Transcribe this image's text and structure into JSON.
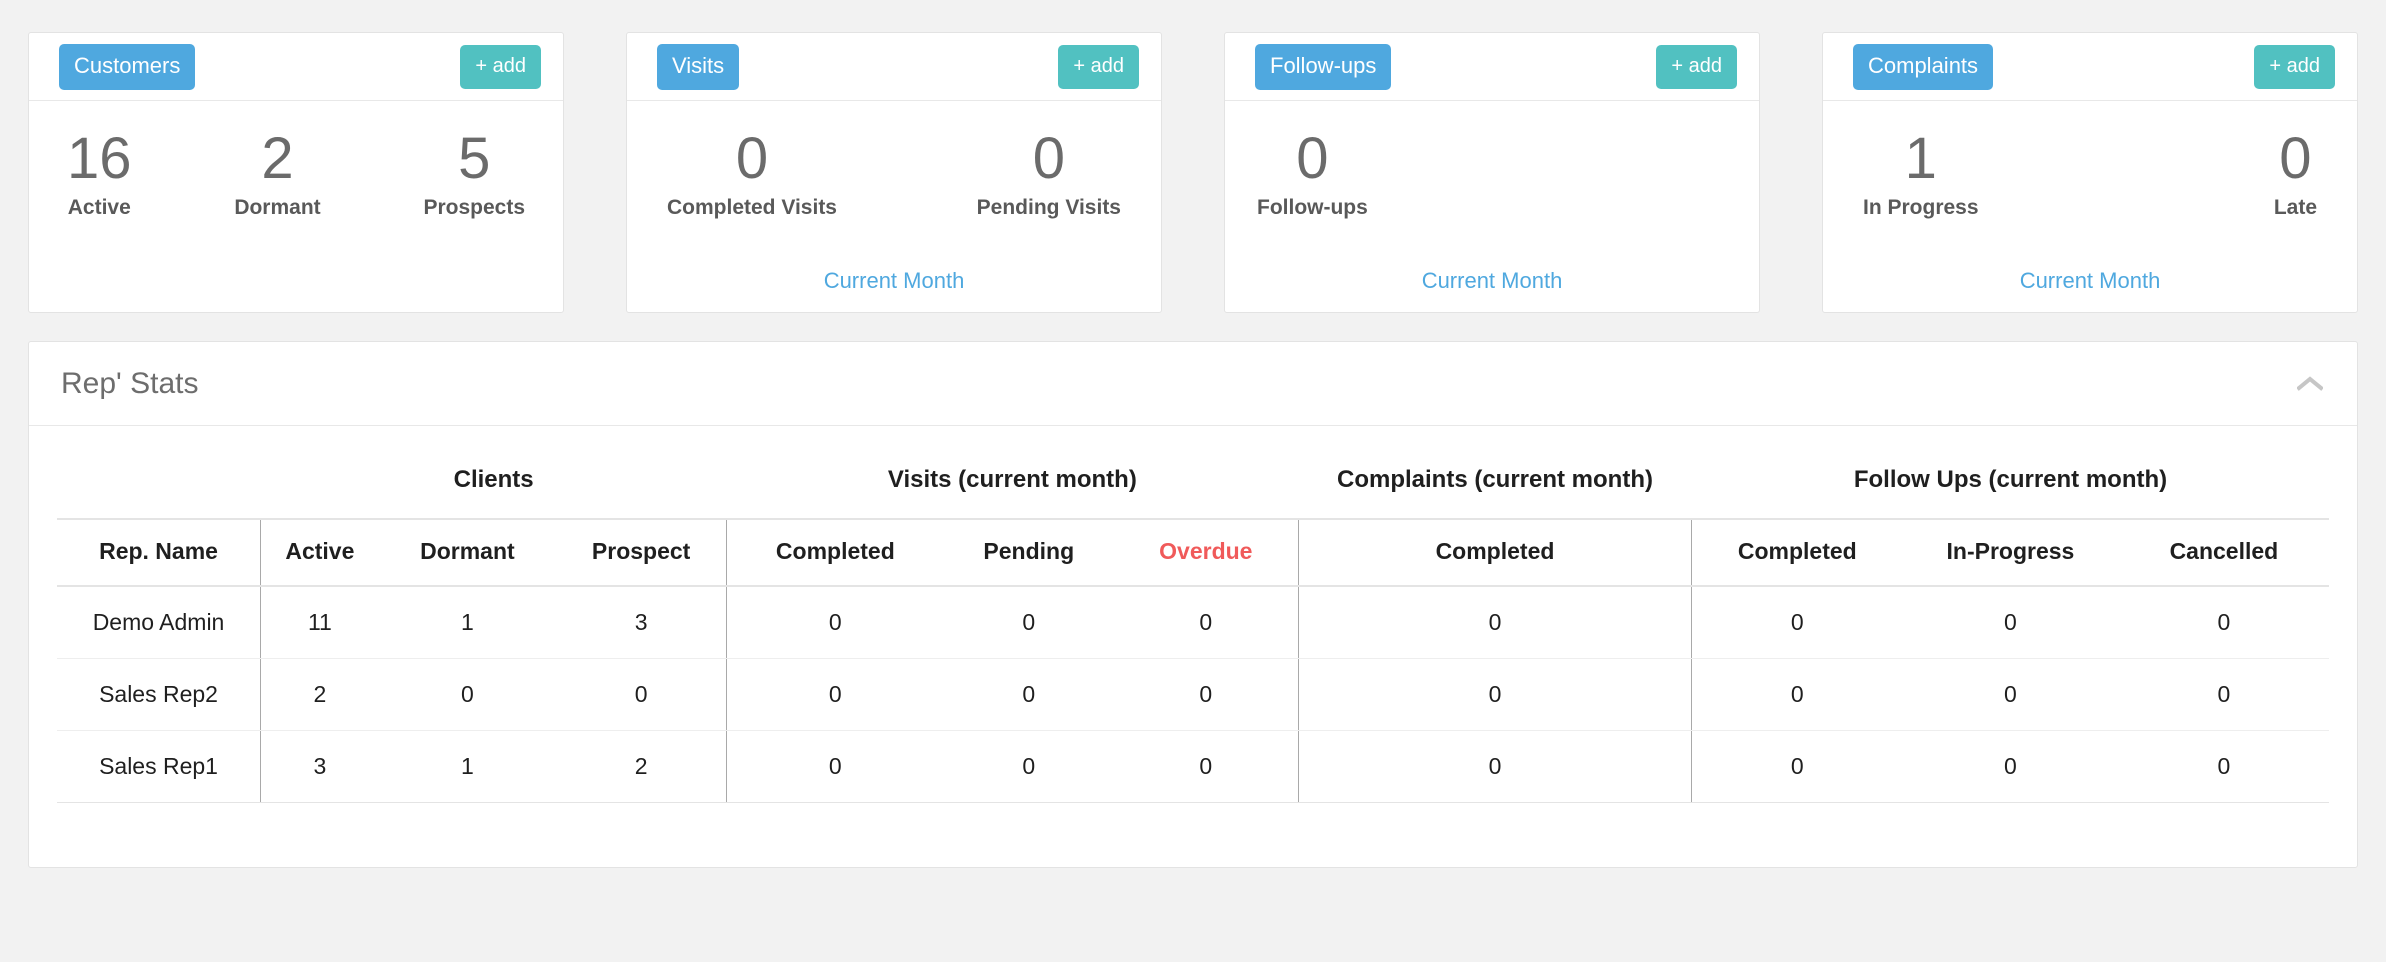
{
  "cards": [
    {
      "name": "customers",
      "badge_label": "Customers",
      "add_label": "+ add",
      "layout": "three",
      "stats": [
        {
          "value": "16",
          "label": "Active"
        },
        {
          "value": "2",
          "label": "Dormant"
        },
        {
          "value": "5",
          "label": "Prospects"
        }
      ],
      "footer_link": ""
    },
    {
      "name": "visits",
      "badge_label": "Visits",
      "add_label": "+ add",
      "layout": "two",
      "stats": [
        {
          "value": "0",
          "label": "Completed Visits"
        },
        {
          "value": "0",
          "label": "Pending Visits"
        }
      ],
      "footer_link": "Current Month"
    },
    {
      "name": "follow-ups",
      "badge_label": "Follow-ups",
      "add_label": "+ add",
      "layout": "one",
      "stats": [
        {
          "value": "0",
          "label": "Follow-ups"
        }
      ],
      "footer_link": "Current Month"
    },
    {
      "name": "complaints",
      "badge_label": "Complaints",
      "add_label": "+ add",
      "layout": "two",
      "stats": [
        {
          "value": "1",
          "label": "In Progress"
        },
        {
          "value": "0",
          "label": "Late"
        }
      ],
      "footer_link": "Current Month"
    }
  ],
  "panel": {
    "title": "Rep' Stats",
    "collapse_icon": "chevron-up-icon"
  },
  "table": {
    "group_headers": {
      "blank": "",
      "clients": "Clients",
      "visits": "Visits (current month)",
      "complaints": "Complaints (current month)",
      "followups": "Follow Ups (current month)"
    },
    "columns": {
      "rep_name": "Rep. Name",
      "clients_active": "Active",
      "clients_dormant": "Dormant",
      "clients_prospect": "Prospect",
      "visits_completed": "Completed",
      "visits_pending": "Pending",
      "visits_overdue": "Overdue",
      "complaints_completed": "Completed",
      "followups_completed": "Completed",
      "followups_inprogress": "In-Progress",
      "followups_cancelled": "Cancelled"
    },
    "rows": [
      {
        "rep_name": "Demo Admin",
        "clients_active": "11",
        "clients_dormant": "1",
        "clients_prospect": "3",
        "visits_completed": "0",
        "visits_pending": "0",
        "visits_overdue": "0",
        "complaints_completed": "0",
        "followups_completed": "0",
        "followups_inprogress": "0",
        "followups_cancelled": "0"
      },
      {
        "rep_name": "Sales Rep2",
        "clients_active": "2",
        "clients_dormant": "0",
        "clients_prospect": "0",
        "visits_completed": "0",
        "visits_pending": "0",
        "visits_overdue": "0",
        "complaints_completed": "0",
        "followups_completed": "0",
        "followups_inprogress": "0",
        "followups_cancelled": "0"
      },
      {
        "rep_name": "Sales Rep1",
        "clients_active": "3",
        "clients_dormant": "1",
        "clients_prospect": "2",
        "visits_completed": "0",
        "visits_pending": "0",
        "visits_overdue": "0",
        "complaints_completed": "0",
        "followups_completed": "0",
        "followups_inprogress": "0",
        "followups_cancelled": "0"
      }
    ]
  },
  "colors": {
    "badge_blue": "#4fa8df",
    "add_teal": "#51c1c1",
    "overdue_red": "#f05a5a",
    "link_blue": "#4fa8df",
    "page_bg": "#f2f2f2"
  }
}
